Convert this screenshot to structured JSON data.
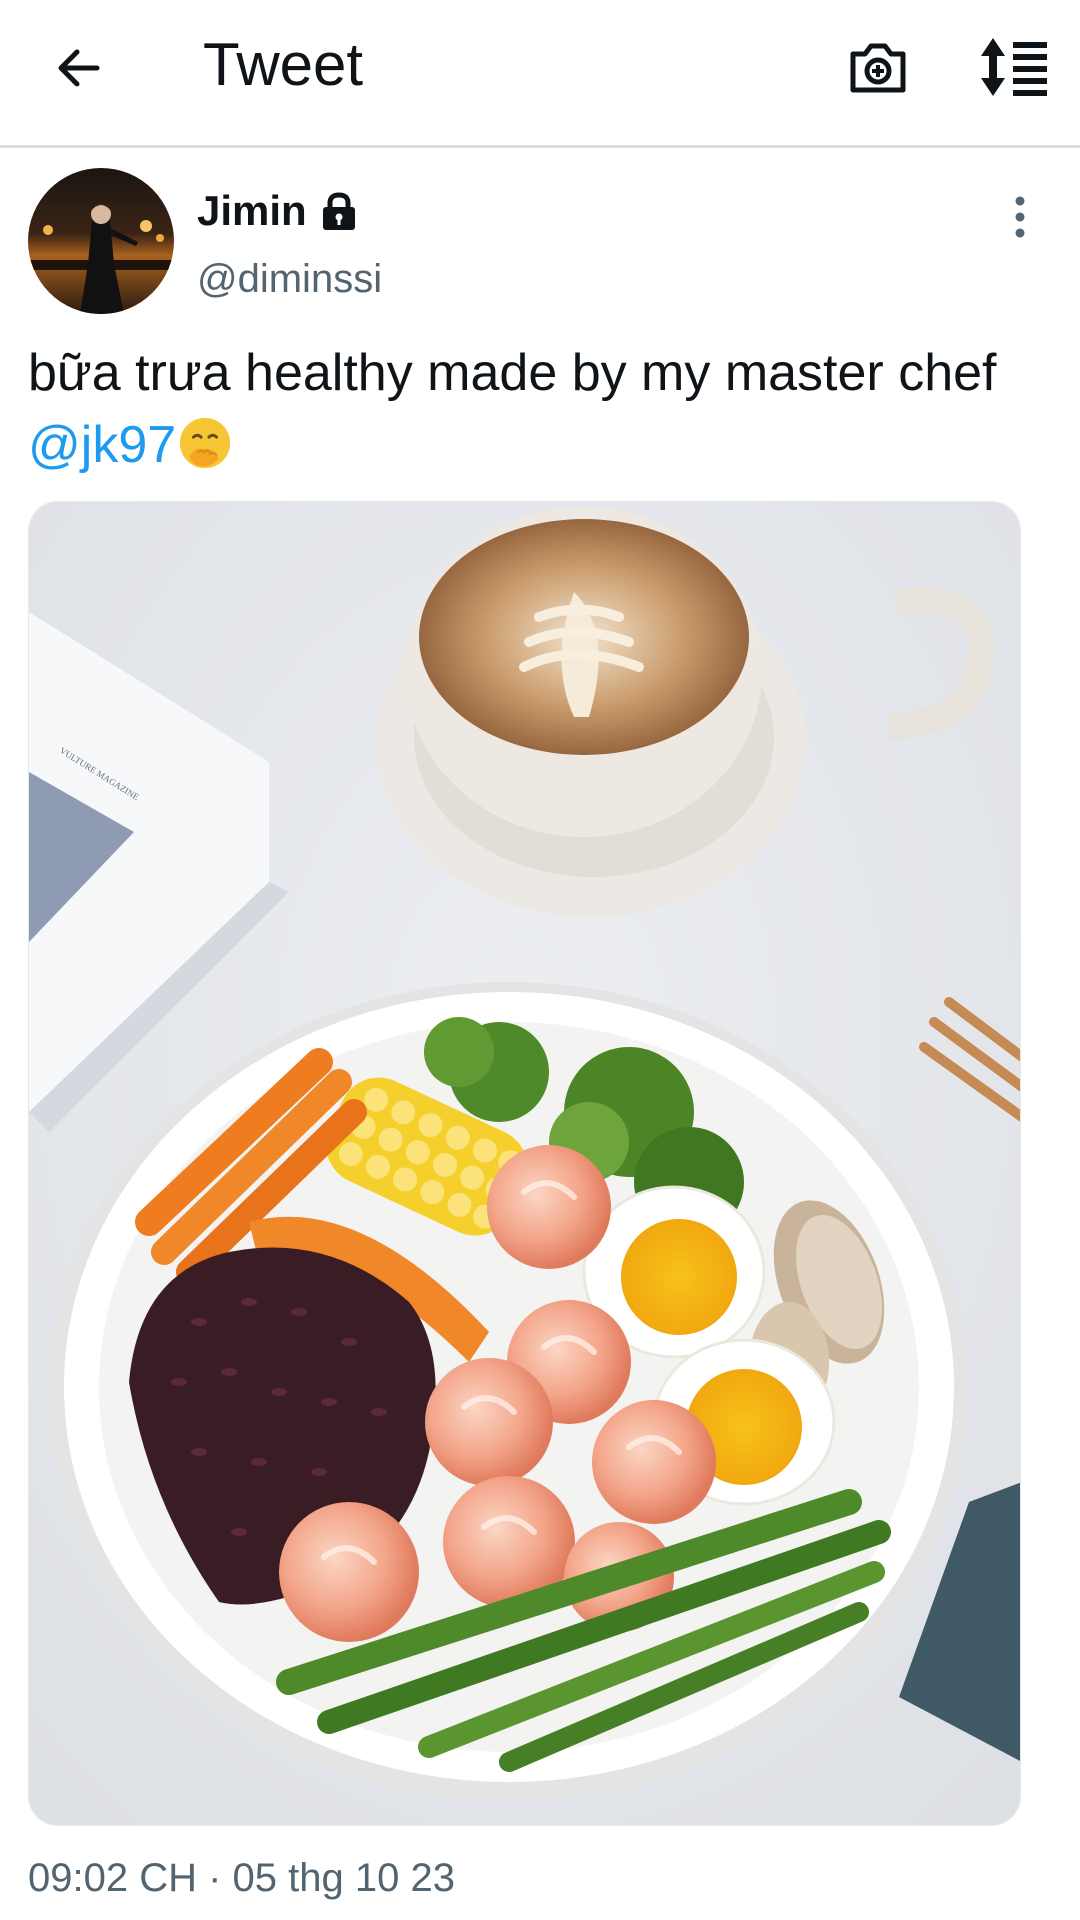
{
  "header": {
    "back_icon": "arrow-left-icon",
    "title": "Tweet",
    "camera_icon": "camera-plus-icon",
    "sort_icon": "sort-list-icon"
  },
  "tweet": {
    "author": {
      "display_name": "Jimin",
      "protected_icon": "lock-icon",
      "handle": "@diminssi"
    },
    "more_icon": "more-vertical-icon",
    "text": "bữa trưa healthy made by my master chef",
    "mention": "@jk97",
    "emoji": "hand-over-mouth-emoji",
    "media_icon": "photo-food-bowl",
    "timestamp": "09:02 CH · 05 thg 10 23"
  },
  "colors": {
    "accent": "#1d9bf0",
    "text_primary": "#0f1419",
    "text_secondary": "#536471",
    "divider": "#dadcdf"
  }
}
